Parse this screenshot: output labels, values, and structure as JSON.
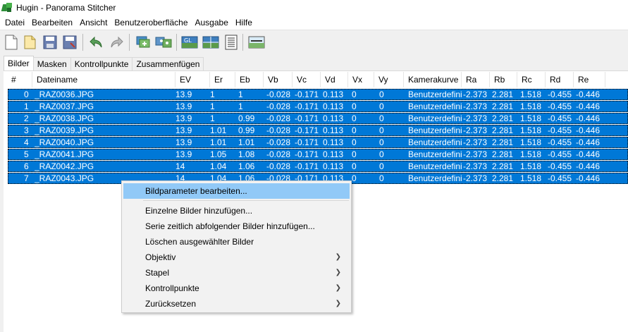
{
  "window": {
    "title": "Hugin - Panorama Stitcher"
  },
  "menubar": [
    "Datei",
    "Bearbeiten",
    "Ansicht",
    "Benutzeroberfläche",
    "Ausgabe",
    "Hilfe"
  ],
  "toolbar": {
    "icons": [
      "new-file-icon",
      "open-folder-icon",
      "save-icon",
      "save-as-icon",
      "undo-icon",
      "redo-icon",
      "add-images-icon",
      "control-points-icon",
      "opengl-preview-icon",
      "fast-preview-icon",
      "image-list-icon",
      "stitch-icon"
    ]
  },
  "tabs": [
    "Bilder",
    "Masken",
    "Kontrollpunkte",
    "Zusammenfügen"
  ],
  "table": {
    "columns": [
      "#",
      "Dateiname",
      "EV",
      "Er",
      "Eb",
      "Vb",
      "Vc",
      "Vd",
      "Vx",
      "Vy",
      "Kamerakurve",
      "Ra",
      "Rb",
      "Rc",
      "Rd",
      "Re"
    ],
    "rows": [
      [
        "0",
        "_RAZ0036.JPG",
        "13.9",
        "1",
        "1",
        "-0.028",
        "-0.171",
        "0.113",
        "0",
        "0",
        "Benutzerdefini",
        "-2.373",
        "2.281",
        "1.518",
        "-0.455",
        "-0.446"
      ],
      [
        "1",
        "_RAZ0037.JPG",
        "13.9",
        "1",
        "1",
        "-0.028",
        "-0.171",
        "0.113",
        "0",
        "0",
        "Benutzerdefini",
        "-2.373",
        "2.281",
        "1.518",
        "-0.455",
        "-0.446"
      ],
      [
        "2",
        "_RAZ0038.JPG",
        "13.9",
        "1",
        "0.99",
        "-0.028",
        "-0.171",
        "0.113",
        "0",
        "0",
        "Benutzerdefini",
        "-2.373",
        "2.281",
        "1.518",
        "-0.455",
        "-0.446"
      ],
      [
        "3",
        "_RAZ0039.JPG",
        "13.9",
        "1.01",
        "0.99",
        "-0.028",
        "-0.171",
        "0.113",
        "0",
        "0",
        "Benutzerdefini",
        "-2.373",
        "2.281",
        "1.518",
        "-0.455",
        "-0.446"
      ],
      [
        "4",
        "_RAZ0040.JPG",
        "13.9",
        "1.01",
        "1.01",
        "-0.028",
        "-0.171",
        "0.113",
        "0",
        "0",
        "Benutzerdefini",
        "-2.373",
        "2.281",
        "1.518",
        "-0.455",
        "-0.446"
      ],
      [
        "5",
        "_RAZ0041.JPG",
        "13.9",
        "1.05",
        "1.08",
        "-0.028",
        "-0.171",
        "0.113",
        "0",
        "0",
        "Benutzerdefini",
        "-2.373",
        "2.281",
        "1.518",
        "-0.455",
        "-0.446"
      ],
      [
        "6",
        "_RAZ0042.JPG",
        "14",
        "1.04",
        "1.06",
        "-0.028",
        "-0.171",
        "0.113",
        "0",
        "0",
        "Benutzerdefini",
        "-2.373",
        "2.281",
        "1.518",
        "-0.455",
        "-0.446"
      ],
      [
        "7",
        "_RAZ0043.JPG",
        "14",
        "1.04",
        "1.06",
        "-0.028",
        "-0.171",
        "0.113",
        "0",
        "0",
        "Benutzerdefini",
        "-2.373",
        "2.281",
        "1.518",
        "-0.455",
        "-0.446"
      ]
    ]
  },
  "context_menu": {
    "items": [
      {
        "label": "Bildparameter bearbeiten...",
        "highlighted": true,
        "submenu": false
      },
      {
        "label": "Einzelne Bilder hinzufügen...",
        "highlighted": false,
        "submenu": false
      },
      {
        "label": "Serie zeitlich abfolgender Bilder hinzufügen...",
        "highlighted": false,
        "submenu": false
      },
      {
        "label": "Löschen ausgewählter Bilder",
        "highlighted": false,
        "submenu": false
      },
      {
        "label": "Objektiv",
        "highlighted": false,
        "submenu": true
      },
      {
        "label": "Stapel",
        "highlighted": false,
        "submenu": true
      },
      {
        "label": "Kontrollpunkte",
        "highlighted": false,
        "submenu": true
      },
      {
        "label": "Zurücksetzen",
        "highlighted": false,
        "submenu": true
      }
    ]
  },
  "colors": {
    "selection": "#0078d7",
    "menu_highlight": "#91c9f7"
  }
}
